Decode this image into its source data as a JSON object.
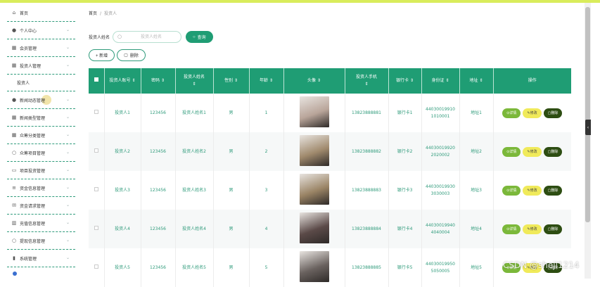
{
  "sidebar": {
    "items": [
      {
        "label": "首页",
        "icon": "home-icon",
        "chevron": false
      },
      {
        "label": "个人中心",
        "icon": "user-icon",
        "chevron": true
      },
      {
        "label": "会员管理",
        "icon": "grid-icon",
        "chevron": true
      },
      {
        "label": "投资人管理",
        "icon": "grid-icon",
        "chevron": true,
        "expanded": true,
        "sub": "投资人"
      },
      {
        "label": "新闻动态管理",
        "icon": "user-icon",
        "chevron": true,
        "hovered": true
      },
      {
        "label": "新闻类型管理",
        "icon": "grid-icon",
        "chevron": true
      },
      {
        "label": "众筹分类管理",
        "icon": "grid-icon",
        "chevron": true
      },
      {
        "label": "众筹项目管理",
        "icon": "circle-icon",
        "chevron": true
      },
      {
        "label": "项目投资管理",
        "icon": "card-icon",
        "chevron": true
      },
      {
        "label": "资金信息管理",
        "icon": "list-icon",
        "chevron": true
      },
      {
        "label": "资金请求管理",
        "icon": "mail-icon",
        "chevron": true
      },
      {
        "label": "充值信息管理",
        "icon": "bank-icon",
        "chevron": true
      },
      {
        "label": "提现信息管理",
        "icon": "circle-icon",
        "chevron": true
      },
      {
        "label": "系统管理",
        "icon": "chart-icon",
        "chevron": true
      }
    ]
  },
  "breadcrumb": {
    "home": "首页",
    "sep": "/",
    "current": "投资人"
  },
  "search": {
    "label": "投资人姓名",
    "placeholder": "投资人姓名",
    "button": "查询",
    "button_icon": "search-icon"
  },
  "actions": {
    "add": "+ 新增",
    "delete": "删除"
  },
  "table": {
    "headers": [
      "投资人账号",
      "密码",
      "投资人姓名",
      "性别",
      "年龄",
      "头像",
      "投资人手机",
      "银行卡",
      "身份证",
      "地址",
      "操作"
    ],
    "sort_marker": "⇕",
    "ops": {
      "detail": "详情",
      "edit": "修改",
      "delete": "删除"
    },
    "rows": [
      {
        "account": "投资人1",
        "password": "123456",
        "name": "投资人姓名1",
        "gender": "男",
        "age": "1",
        "avatar_color": "#b9a59a",
        "phone": "13823888881",
        "card": "银行卡1",
        "id_a": "44030019910",
        "id_b": "1010001",
        "address": "地址1"
      },
      {
        "account": "投资人2",
        "password": "123456",
        "name": "投资人姓名2",
        "gender": "男",
        "age": "2",
        "avatar_color": "#a08a6d",
        "phone": "13823888882",
        "card": "银行卡2",
        "id_a": "44030019920",
        "id_b": "2020002",
        "address": "地址2"
      },
      {
        "account": "投资人3",
        "password": "123456",
        "name": "投资人姓名3",
        "gender": "男",
        "age": "3",
        "avatar_color": "#9a8465",
        "phone": "13823888883",
        "card": "银行卡3",
        "id_a": "44030019930",
        "id_b": "3030003",
        "address": "地址3"
      },
      {
        "account": "投资人4",
        "password": "123456",
        "name": "投资人姓名4",
        "gender": "男",
        "age": "4",
        "avatar_color": "#5b4a48",
        "phone": "13823888884",
        "card": "银行卡4",
        "id_a": "44030019940",
        "id_b": "4040004",
        "address": "地址4"
      },
      {
        "account": "投资人5",
        "password": "123456",
        "name": "投资人姓名5",
        "gender": "男",
        "age": "5",
        "avatar_color": "#6a625f",
        "phone": "13823888885",
        "card": "银行卡5",
        "id_a": "44030019950",
        "id_b": "5050005",
        "address": "地址5"
      }
    ]
  },
  "watermark": "CSDN @shejl1214",
  "colors": {
    "primary": "#1f9d74",
    "detail": "#7bb83a",
    "edit": "#f0ea5a",
    "delete": "#2d4d12",
    "topline": "#d9ec5b"
  }
}
